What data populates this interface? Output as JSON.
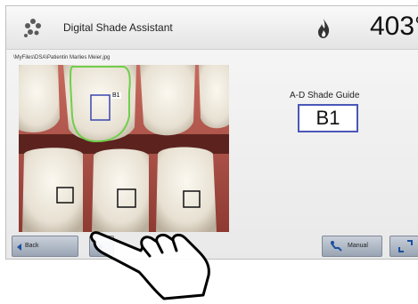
{
  "header": {
    "title": "Digital Shade Assistant",
    "temperature": "403°"
  },
  "file_path": "\\MyFiles\\DSA\\Patientin Marlies Meier.jpg",
  "photo": {
    "selection_label": "B1"
  },
  "shade_guide": {
    "label": "A-D Shade Guide",
    "value": "B1"
  },
  "footer": {
    "back_label": "Back",
    "manual_label": "Manual"
  },
  "colors": {
    "accent": "#1a4fa0",
    "selection_outline": "#6fcf4a",
    "shade_border": "#4a57b8"
  },
  "icons": [
    "molar-app-icon",
    "flame-icon",
    "back-arrow-icon",
    "forward-arrow-icon",
    "manual-hand-icon",
    "expand-icon",
    "pointing-hand-icon"
  ]
}
